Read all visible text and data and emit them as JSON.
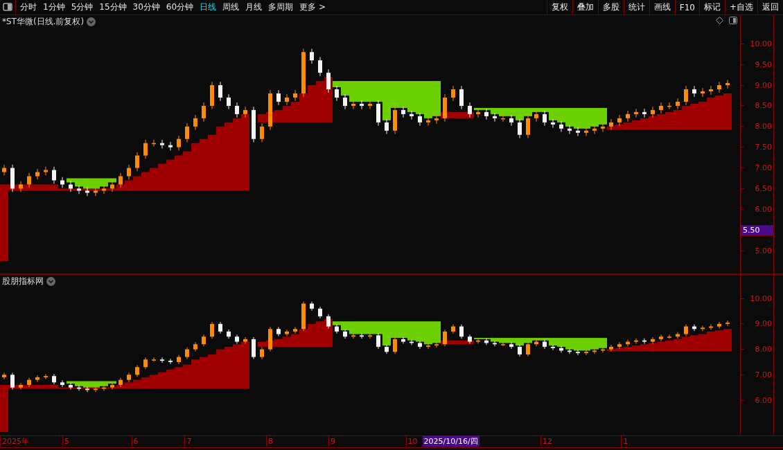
{
  "toolbar": {
    "tabs": [
      {
        "label": "分时",
        "selected": false
      },
      {
        "label": "1分钟",
        "selected": false
      },
      {
        "label": "5分钟",
        "selected": false
      },
      {
        "label": "15分钟",
        "selected": false
      },
      {
        "label": "30分钟",
        "selected": false
      },
      {
        "label": "60分钟",
        "selected": false
      },
      {
        "label": "日线",
        "selected": true
      },
      {
        "label": "周线",
        "selected": false
      },
      {
        "label": "月线",
        "selected": false
      },
      {
        "label": "多周期",
        "selected": false
      },
      {
        "label": "更多 >",
        "selected": false
      }
    ],
    "buttons": [
      "复权",
      "叠加",
      "多股",
      "统计",
      "画线",
      "F10",
      "标记",
      "+自选",
      "返回"
    ]
  },
  "panels": [
    {
      "title": "*ST华微(日线.前复权)",
      "price_labels": [
        "10.00",
        "9.50",
        "9.00",
        "8.50",
        "8.00",
        "7.50",
        "7.00",
        "6.50",
        "6.00",
        "5.00"
      ],
      "cursor_price": "5.50"
    },
    {
      "title": "股朋指标网",
      "price_labels": [
        "10.00",
        "9.00",
        "8.00",
        "7.00",
        "6.00"
      ]
    }
  ],
  "time_axis": {
    "labels": [
      "2025年",
      "5",
      "6",
      "7",
      "8",
      "9",
      "10",
      "12",
      "1"
    ],
    "cursor_date": "2025/10/16/四"
  }
}
